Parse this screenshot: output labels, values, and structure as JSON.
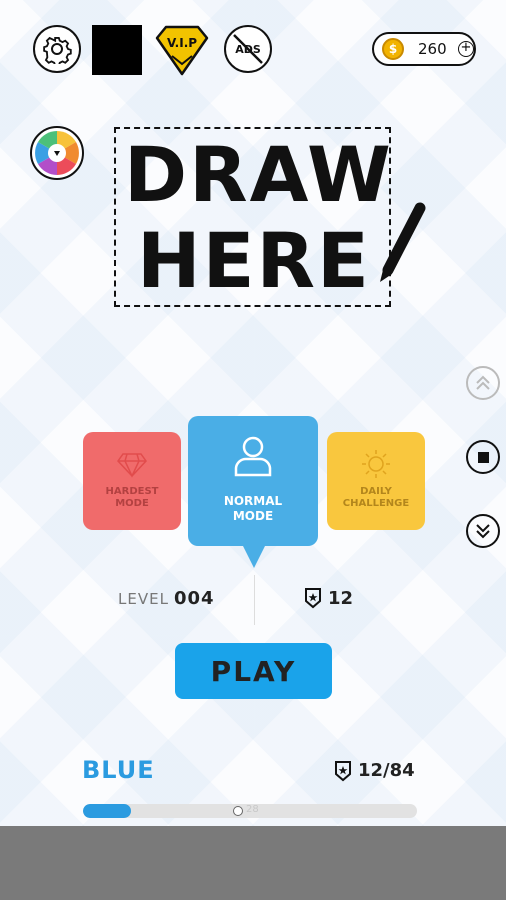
{
  "header": {
    "vip_label": "V.I.P",
    "ads_label": "ADS",
    "coins": "260",
    "coin_symbol": "$"
  },
  "canvas": {
    "draw_line1": "DRAW",
    "draw_line2": "HERE"
  },
  "modes": [
    {
      "label_line1": "HARDEST",
      "label_line2": "MODE"
    },
    {
      "label_line1": "NORMAL",
      "label_line2": "MODE"
    },
    {
      "label_line1": "DAILY",
      "label_line2": "CHALLENGE"
    }
  ],
  "stats": {
    "level_label": "LEVEL",
    "level_value": "004",
    "stars": "12"
  },
  "play_label": "PLAY",
  "progress": {
    "color_name": "BLUE",
    "count": "12/84",
    "fraction": 0.1429,
    "marker_text": "28"
  },
  "colors": {
    "accent_blue": "#4aaee6",
    "play_blue": "#1aa3ea",
    "hardest_red": "#f06b6b",
    "daily_yellow": "#f9c73e",
    "vip_gold": "#f2c300"
  },
  "icons": {
    "settings": "gear-icon",
    "vip": "vip-badge-icon",
    "ads": "no-ads-icon",
    "coin": "coin-icon",
    "palette": "color-wheel-icon",
    "scroll_up": "double-chevron-up-icon",
    "stop": "stop-icon",
    "scroll_down": "double-chevron-down-icon",
    "hardest": "diamond-icon",
    "normal": "person-icon",
    "daily": "sun-icon",
    "star_shield": "star-shield-icon"
  }
}
